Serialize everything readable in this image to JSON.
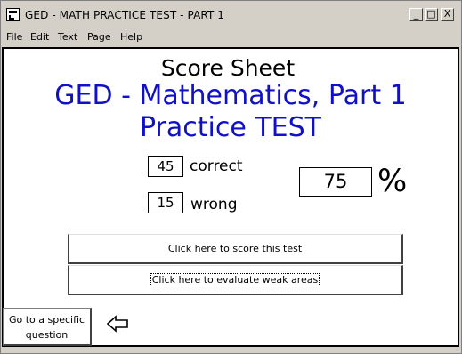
{
  "window": {
    "title": "GED - MATH PRACTICE TEST - PART 1",
    "controls": {
      "minimize": "_",
      "maximize": "□",
      "close": "X"
    }
  },
  "menu": [
    "File",
    "Edit",
    "Text",
    "Page",
    "Help"
  ],
  "sheet": {
    "heading": "Score Sheet",
    "subtitle_line1": "GED - Mathematics, Part 1",
    "subtitle_line2": "Practice TEST",
    "accent_color": "#1010c8"
  },
  "results": {
    "correct_value": "45",
    "correct_label": "correct",
    "wrong_value": "15",
    "wrong_label": "wrong",
    "percent_value": "75",
    "percent_sign": "%"
  },
  "actions": {
    "score_label": "Click here to score this test",
    "evaluate_label": "Click here to evaluate weak areas",
    "goto_label": "Go to a specific question",
    "back_icon": "back-arrow-icon"
  }
}
